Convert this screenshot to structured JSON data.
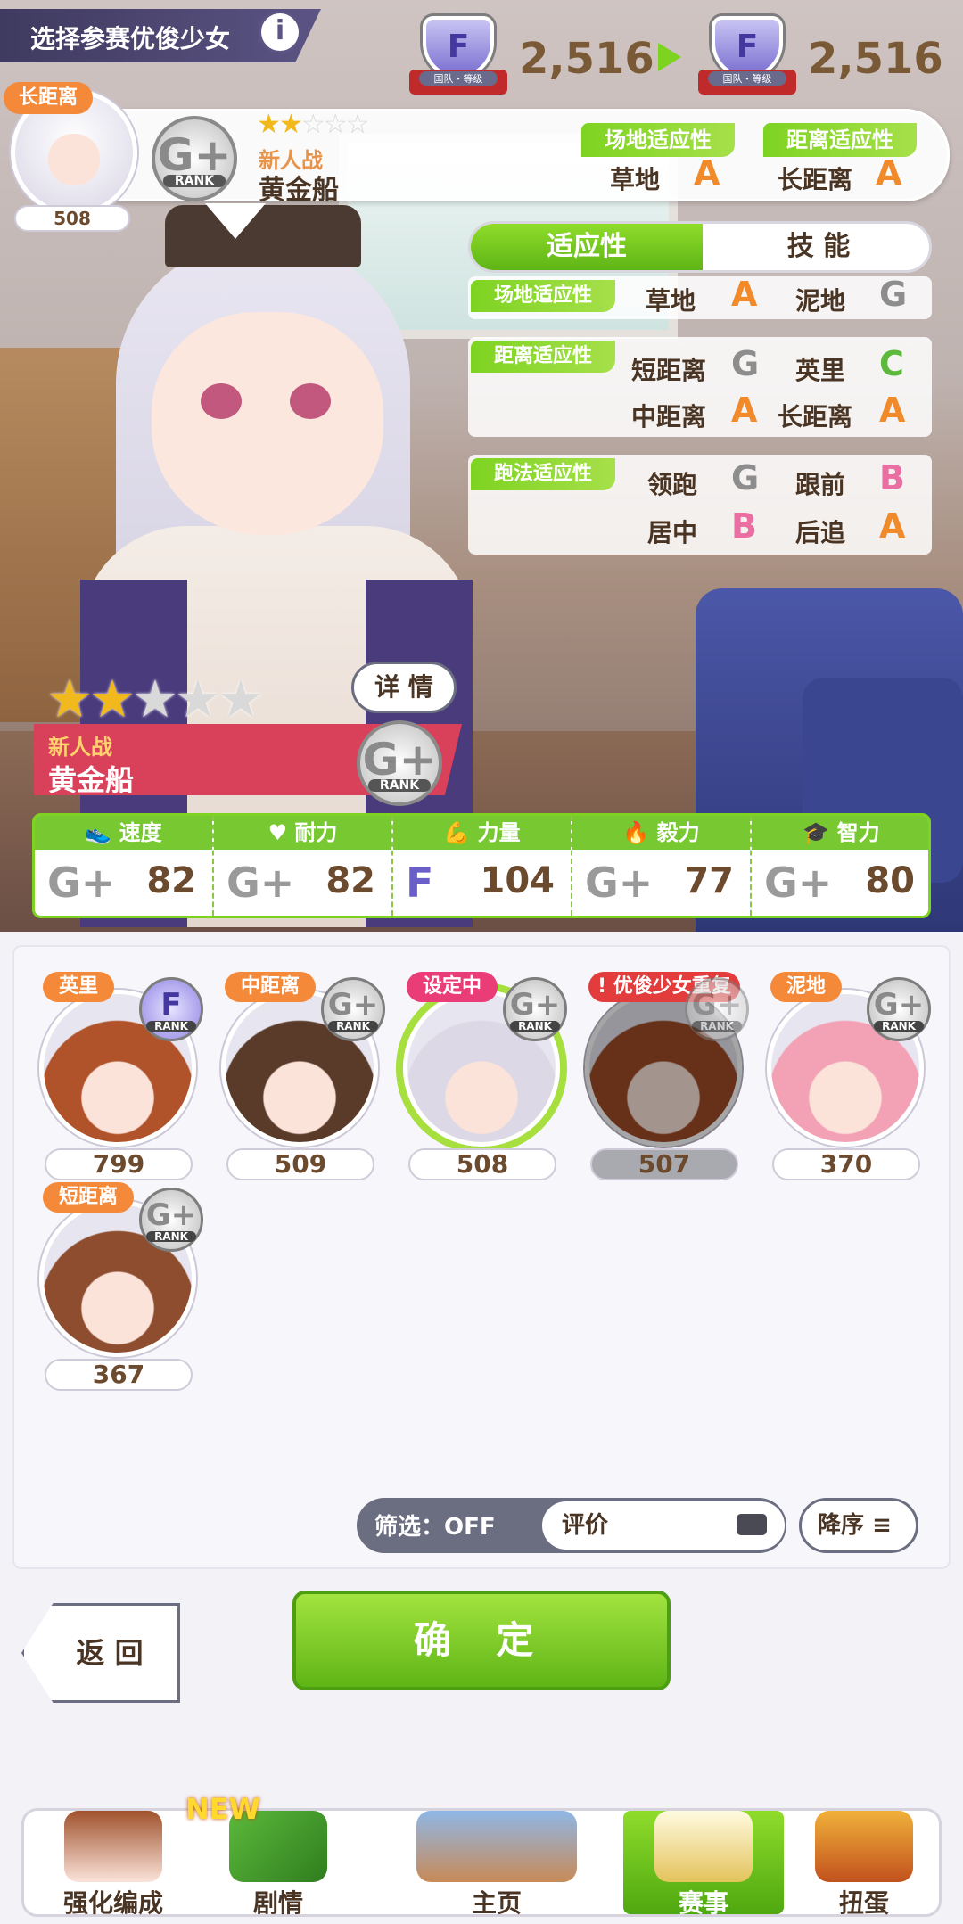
{
  "header": {
    "title": "选择参赛优俊少女",
    "info_label": "i",
    "team_rank_left": {
      "label": "国队・等级",
      "grade": "F",
      "value": "2,516"
    },
    "team_rank_right": {
      "label": "国队・等级",
      "grade": "F",
      "value": "2,516"
    }
  },
  "selected": {
    "distance_tag": "长距离",
    "id_number": "508",
    "rank": "G+",
    "rank_caption": "RANK",
    "stars_filled": 2,
    "stars_total": 5,
    "subtitle": "新人战",
    "name": "黄金船",
    "surface_label": "场地适应性",
    "surface_type": "草地",
    "surface_grade": "A",
    "distance_label": "距离适应性",
    "distance_type": "长距离",
    "distance_grade": "A"
  },
  "tabs": {
    "aptitude": "适应性",
    "skills": "技 能"
  },
  "aptitude": {
    "surface": {
      "label": "场地适应性",
      "items": [
        {
          "name": "草地",
          "grade": "A"
        },
        {
          "name": "泥地",
          "grade": "G"
        }
      ]
    },
    "distance": {
      "label": "距离适应性",
      "items": [
        {
          "name": "短距离",
          "grade": "G"
        },
        {
          "name": "英里",
          "grade": "C"
        },
        {
          "name": "中距离",
          "grade": "A"
        },
        {
          "name": "长距离",
          "grade": "A"
        }
      ]
    },
    "strategy": {
      "label": "跑法适应性",
      "items": [
        {
          "name": "领跑",
          "grade": "G"
        },
        {
          "name": "跟前",
          "grade": "B"
        },
        {
          "name": "居中",
          "grade": "B"
        },
        {
          "name": "后追",
          "grade": "A"
        }
      ]
    }
  },
  "character": {
    "stars_filled": 2,
    "stars_total": 5,
    "details_button": "详 情",
    "subtitle": "新人战",
    "name": "黄金船",
    "rank": "G+",
    "rank_caption": "RANK"
  },
  "stats": [
    {
      "label": "速度",
      "grade": "G+",
      "value": "82",
      "icon": "shoe-icon"
    },
    {
      "label": "耐力",
      "grade": "G+",
      "value": "82",
      "icon": "heart-icon"
    },
    {
      "label": "力量",
      "grade": "F",
      "value": "104",
      "icon": "muscle-icon"
    },
    {
      "label": "毅力",
      "grade": "G+",
      "value": "77",
      "icon": "flame-icon"
    },
    {
      "label": "智力",
      "grade": "G+",
      "value": "80",
      "icon": "graduation-cap-icon"
    }
  ],
  "roster": [
    {
      "tag": "英里",
      "rank": "F",
      "number": "799",
      "hair": "#b0532a"
    },
    {
      "tag": "中距离",
      "rank": "G+",
      "number": "509",
      "hair": "#5a3b2a"
    },
    {
      "tag": "设定中",
      "rank": "G+",
      "number": "508",
      "hair": "#dcd8e6"
    },
    {
      "tag": "优俊少女重复",
      "rank": "G+",
      "number": "507",
      "hair": "#9e4a26"
    },
    {
      "tag": "泥地",
      "rank": "G+",
      "number": "370",
      "hair": "#f3a2b6"
    },
    {
      "tag": "短距离",
      "rank": "G+",
      "number": "367",
      "hair": "#8e4d2e"
    }
  ],
  "filter": {
    "label": "筛选：OFF",
    "sort_field": "评价",
    "order": "降序"
  },
  "buttons": {
    "back": "返 回",
    "confirm": "确 定"
  },
  "nav": {
    "new_badge": "NEW",
    "items": [
      {
        "label": "强化编成",
        "icon": "team-icon"
      },
      {
        "label": "剧情",
        "icon": "story-book-icon"
      },
      {
        "label": "主页",
        "icon": "home-building-icon"
      },
      {
        "label": "赛事",
        "icon": "race-podium-icon"
      },
      {
        "label": "扭蛋",
        "icon": "gacha-icon"
      }
    ]
  },
  "colors": {
    "accent_green": "#7ed321",
    "tag_orange": "#f5893a",
    "tag_pink": "#ea3d77",
    "tag_red": "#e23c3c"
  }
}
